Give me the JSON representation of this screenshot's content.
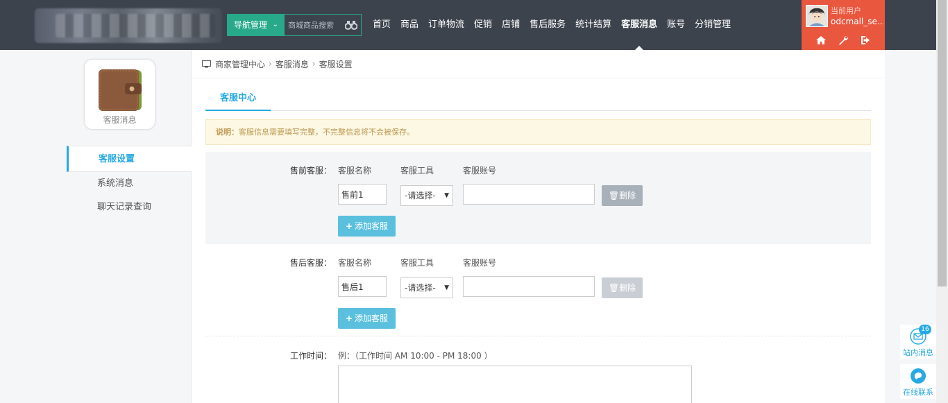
{
  "header": {
    "nav_mgmt": "导航管理",
    "search_placeholder": "商城商品搜索",
    "nav_items": [
      "首页",
      "商品",
      "订单物流",
      "促销",
      "店铺",
      "售后服务",
      "统计结算",
      "客服消息",
      "账号",
      "分销管理"
    ],
    "active_nav": "客服消息",
    "user_label": "当前用户",
    "user_name": "odcmall_se..."
  },
  "sidebar": {
    "app_label": "客服消息",
    "items": [
      {
        "label": "客服设置",
        "active": true
      },
      {
        "label": "系统消息",
        "active": false
      },
      {
        "label": "聊天记录查询",
        "active": false
      }
    ]
  },
  "breadcrumb": [
    "商家管理中心",
    "客服消息",
    "客服设置"
  ],
  "tab": "客服中心",
  "notice": {
    "prefix": "说明：",
    "text": "客服信息需要填写完整，不完整信息将不会被保存。"
  },
  "form": {
    "col_name": "客服名称",
    "col_tool": "客服工具",
    "col_account": "客服账号",
    "pre_sale": {
      "label": "售前客服：",
      "name_value": "售前1",
      "tool_value": "-请选择-",
      "account_value": ""
    },
    "after_sale": {
      "label": "售后客服：",
      "name_value": "售后1",
      "tool_value": "-请选择-",
      "account_value": ""
    },
    "delete_label": "删除",
    "add_label": "添加客服",
    "work_time_label": "工作时间：",
    "work_time_example": "例：（工作时间 AM 10:00 - PM 18:00 ）"
  },
  "float_tools": {
    "message_label": "站内消息",
    "message_count": "16",
    "contact_label": "在线联系"
  },
  "colors": {
    "topbar": "#3d434d",
    "nav_green": "#27a98a",
    "user_orange": "#e9573f",
    "accent_blue": "#27a9e3",
    "add_button": "#5bc0de"
  }
}
